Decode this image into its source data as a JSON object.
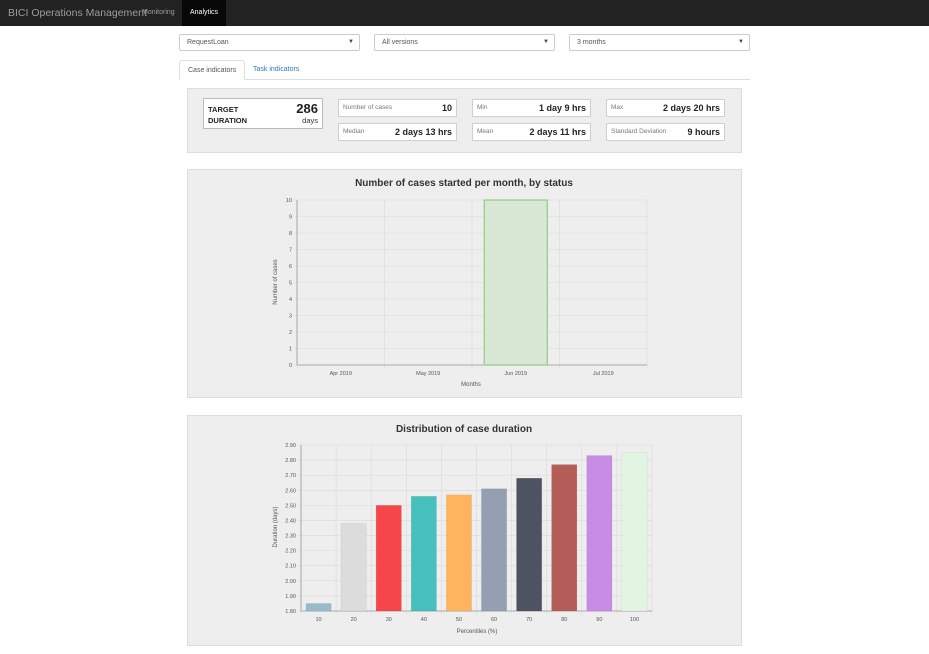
{
  "navbar": {
    "brand": "BICI Operations Management",
    "tabs": [
      {
        "label": "Monitoring",
        "active": false
      },
      {
        "label": "Analytics",
        "active": true
      }
    ]
  },
  "filters": {
    "process": "RequestLoan",
    "version": "All versions",
    "period": "3 months"
  },
  "content_tabs": [
    {
      "label": "Case indicators",
      "active": true
    },
    {
      "label": "Task indicators",
      "active": false
    }
  ],
  "target": {
    "label": "TARGET DURATION",
    "value": "286",
    "unit": "days"
  },
  "kpis": [
    {
      "label": "Number of cases",
      "value": "10"
    },
    {
      "label": "Min",
      "value": "1 day 9 hrs"
    },
    {
      "label": "Max",
      "value": "2 days 20 hrs"
    },
    {
      "label": "Median",
      "value": "2 days 13 hrs"
    },
    {
      "label": "Mean",
      "value": "2 days 11 hrs"
    },
    {
      "label": "Standard Deviation",
      "value": "9 hours"
    }
  ],
  "chart_data": [
    {
      "type": "bar",
      "title": "Number of cases started per month, by status",
      "xlabel": "Months",
      "ylabel": "Number of cases",
      "categories": [
        "Apr 2019",
        "May 2019",
        "Jun 2019",
        "Jul 2019"
      ],
      "values": [
        0,
        0,
        10,
        0
      ],
      "ylim": [
        0,
        10
      ],
      "yticks": [
        0,
        1,
        2,
        3,
        4,
        5,
        6,
        7,
        8,
        9,
        10
      ],
      "grid": true,
      "bar_color": "#d8e8d4",
      "bar_border": "#8fcc85"
    },
    {
      "type": "bar",
      "title": "Distribution of case duration",
      "xlabel": "Percentiles (%)",
      "ylabel": "Duration (days)",
      "categories": [
        "10",
        "20",
        "30",
        "40",
        "50",
        "60",
        "70",
        "80",
        "90",
        "100"
      ],
      "values": [
        1.85,
        2.38,
        2.5,
        2.56,
        2.57,
        2.61,
        2.68,
        2.77,
        2.83,
        2.85
      ],
      "ylim": [
        1.8,
        2.9
      ],
      "yticks": [
        "1.80",
        "1.90",
        "2.00",
        "2.10",
        "2.20",
        "2.30",
        "2.40",
        "2.50",
        "2.60",
        "2.70",
        "2.80",
        "2.90"
      ],
      "grid": true,
      "colors": [
        "#97bbcd",
        "#dcdcdc",
        "#f7464a",
        "#46bfbd",
        "#fdb45c",
        "#949fb1",
        "#4d5360",
        "#b55d59",
        "#c78ce6",
        "#e2f5e2"
      ]
    }
  ]
}
